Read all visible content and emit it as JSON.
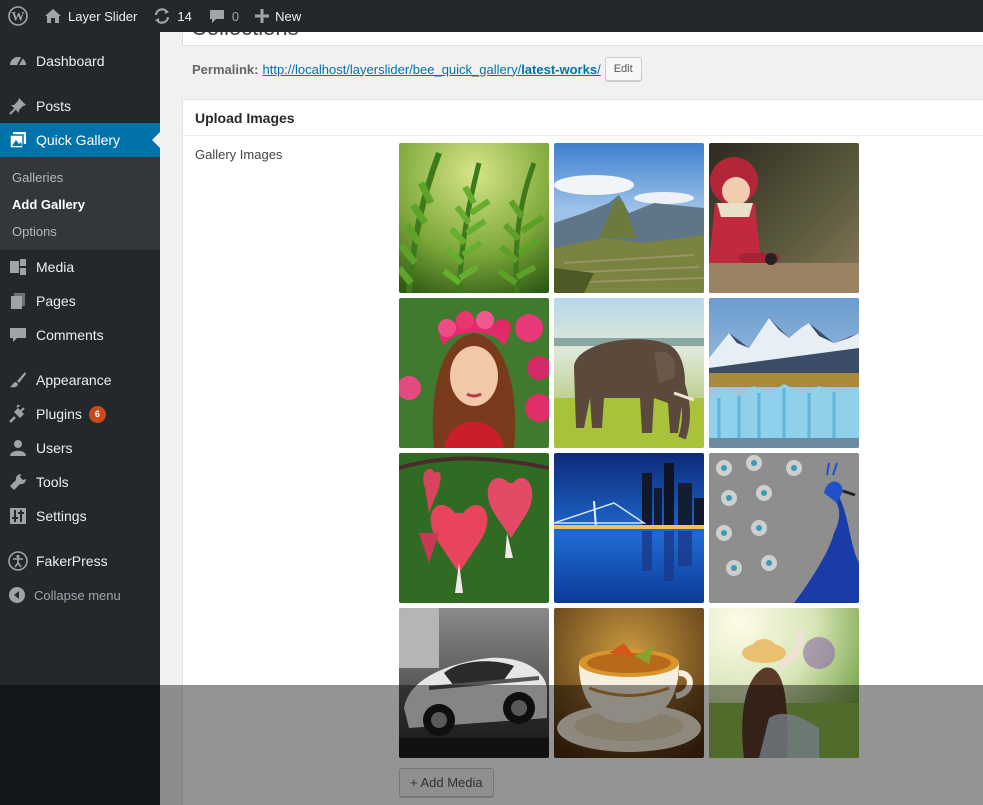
{
  "adminbar": {
    "site_name": "Layer Slider",
    "updates_count": "14",
    "comments_count": "0",
    "new_label": "New"
  },
  "sidebar": {
    "dashboard": "Dashboard",
    "posts": "Posts",
    "quick_gallery": "Quick Gallery",
    "sub": {
      "galleries": "Galleries",
      "add_gallery": "Add Gallery",
      "options": "Options"
    },
    "media": "Media",
    "pages": "Pages",
    "comments": "Comments",
    "appearance": "Appearance",
    "plugins": "Plugins",
    "plugins_badge": "6",
    "users": "Users",
    "tools": "Tools",
    "settings": "Settings",
    "fakerpress": "FakerPress",
    "collapse": "Collapse menu"
  },
  "editor": {
    "title_value": "Collections",
    "permalink_label": "Permalink:",
    "permalink_base": "http://localhost/layerslider/bee_quick_gallery/",
    "permalink_slug": "latest-works",
    "permalink_trailing": "/",
    "edit_button": "Edit"
  },
  "upload": {
    "box_title": "Upload Images",
    "field_label": "Gallery Images",
    "images": [
      "fern-leaves-image",
      "machu-picchu-image",
      "toy-figure-image",
      "flower-crown-woman-image",
      "elephant-image",
      "glacier-mountains-image",
      "bleeding-heart-flowers-image",
      "city-skyline-night-image",
      "peacock-image",
      "sports-car-image",
      "tea-cup-image",
      "woman-meadow-image"
    ],
    "add_media_button": "+ Add Media"
  },
  "colors": {
    "accent": "#0073aa",
    "sidebar_bg": "#23282d",
    "badge": "#ca4a1f"
  }
}
